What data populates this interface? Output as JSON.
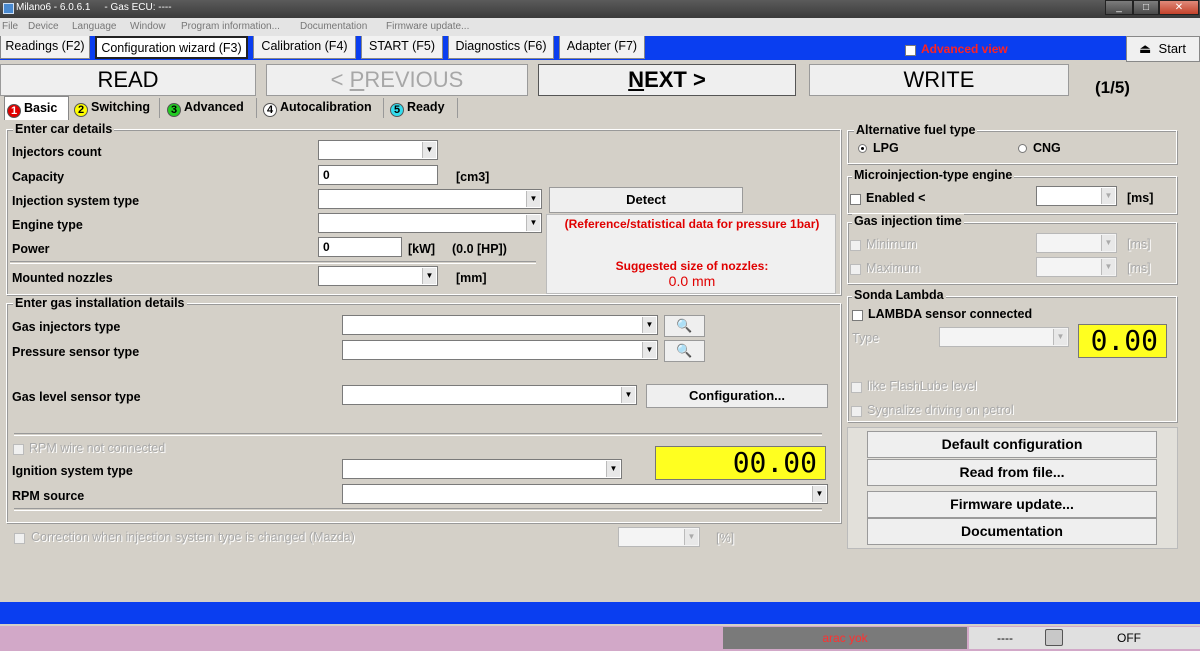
{
  "window": {
    "title": "Milano6 - 6.0.6.1     - Gas ECU: ----",
    "minimize": "_",
    "maximize": "□",
    "close": "✕"
  },
  "menu": [
    "File",
    "Device",
    "Language",
    "Window",
    "Program information...",
    "Documentation",
    "Firmware update..."
  ],
  "top_tabs": [
    "Readings (F2)",
    "Configuration wizard (F3)",
    "Calibration (F4)",
    "START (F5)",
    "Diagnostics (F6)",
    "Adapter (F7)"
  ],
  "advanced_view": "Advanced view",
  "start_button": "Start",
  "nav": {
    "read": "READ",
    "previous_prefix": "< ",
    "previous_key": "P",
    "previous_rest": "REVIOUS",
    "next_key": "N",
    "next_rest": "EXT >",
    "write": "WRITE",
    "step": "(1/5)"
  },
  "wizard_tabs": [
    {
      "num": "1",
      "label": "Basic",
      "color": "#e00000"
    },
    {
      "num": "2",
      "label": "Switching",
      "color": "#ffff00"
    },
    {
      "num": "3",
      "label": "Advanced",
      "color": "#22cc22"
    },
    {
      "num": "4",
      "label": "Autocalibration",
      "color": "#ffffff"
    },
    {
      "num": "5",
      "label": "Ready",
      "color": "#33ddee"
    }
  ],
  "car": {
    "title": "Enter car details",
    "injectors_count": "Injectors count",
    "capacity": "Capacity",
    "capacity_value": "0",
    "capacity_unit": "[cm3]",
    "injection_system_type": "Injection system type",
    "engine_type": "Engine type",
    "power": "Power",
    "power_value": "0",
    "power_unit": "[kW]",
    "power_hp": "(0.0 [HP])",
    "mounted_nozzles": "Mounted nozzles",
    "nozzles_unit": "[mm]",
    "detect": "Detect",
    "reference_note": "(Reference/statistical data for pressure 1bar)",
    "suggested_label": "Suggested size of nozzles:",
    "suggested_value": "0.0 mm"
  },
  "gas": {
    "title": "Enter gas installation details",
    "injectors_type": "Gas injectors type",
    "pressure_sensor_type": "Pressure sensor type",
    "level_sensor_type": "Gas level sensor type",
    "configuration": "Configuration...",
    "rpm_wire": "RPM wire not connected",
    "ignition_system_type": "Ignition system type",
    "rpm_source": "RPM source",
    "rpm_display": "00.00"
  },
  "correction": {
    "label": "Correction when injection system type  is changed (Mazda)",
    "unit": "[%]"
  },
  "fuel": {
    "title": "Alternative fuel type",
    "lpg": "LPG",
    "cng": "CNG"
  },
  "micro": {
    "title": "Microinjection-type engine",
    "enabled": "Enabled <",
    "unit": "[ms]"
  },
  "injection_time": {
    "title": "Gas injection time",
    "minimum": "Minimum",
    "maximum": "Maximum",
    "unit": "[ms]"
  },
  "lambda": {
    "title": "Sonda Lambda",
    "connected": "LAMBDA sensor connected",
    "type": "Type",
    "display": "0.00",
    "flashlube": "like FlashLube level",
    "signalize": "Sygnalize driving on petrol"
  },
  "actions": {
    "default": "Default configuration",
    "read_file": "Read from file...",
    "firmware": "Firmware update...",
    "documentation": "Documentation"
  },
  "status": {
    "car": "arac yok",
    "dashes": "----",
    "off": "OFF"
  }
}
